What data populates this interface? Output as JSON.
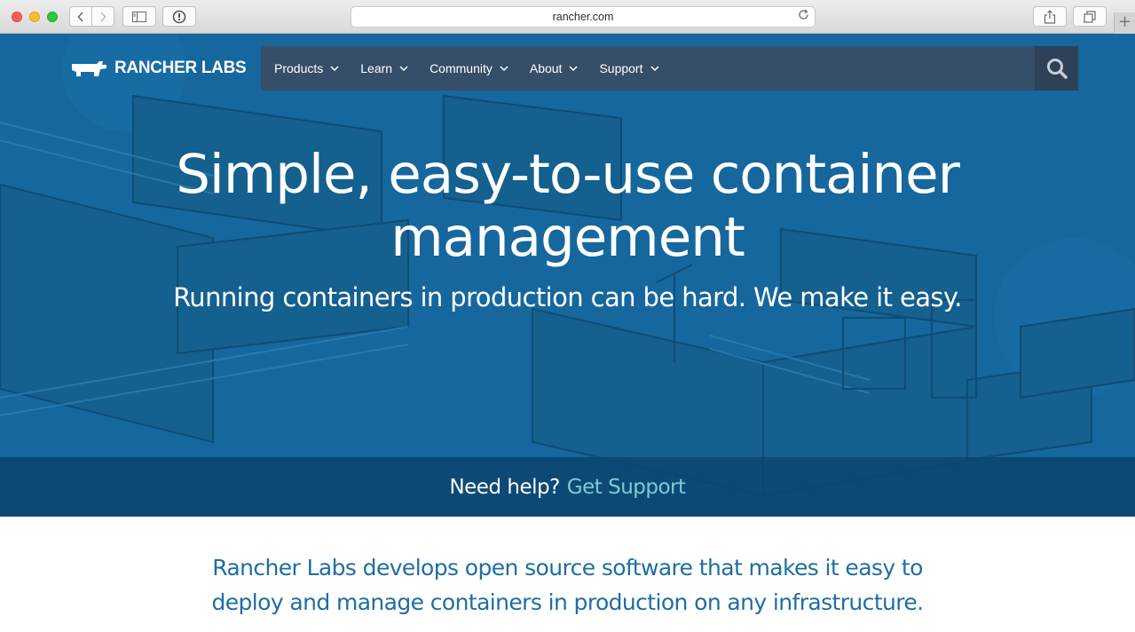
{
  "browser": {
    "url": "rancher.com",
    "back_icon": "chevron-left-icon",
    "forward_icon": "chevron-right-icon",
    "sidebar_icon": "sidebar-icon",
    "reader_icon": "reader-icon",
    "reload_icon": "reload-icon",
    "share_icon": "share-icon",
    "tabs_icon": "tabs-icon",
    "newtab_label": "+"
  },
  "nav": {
    "logo_text": "RANCHER LABS",
    "items": [
      {
        "label": "Products"
      },
      {
        "label": "Learn"
      },
      {
        "label": "Community"
      },
      {
        "label": "About"
      },
      {
        "label": "Support"
      }
    ],
    "search_icon": "search-icon"
  },
  "hero": {
    "headline_line1": "Simple, easy-to-use container",
    "headline_line2": "management",
    "subheadline": "Running containers in production can be hard. We make it easy."
  },
  "helpbar": {
    "text": "Need help?",
    "link": "Get Support"
  },
  "intro": {
    "line1": "Rancher Labs develops open source software that makes it easy to",
    "line2": "deploy and manage containers in production on any infrastructure."
  },
  "colors": {
    "hero_bg": "#16679d",
    "nav_bg": "#374e69",
    "link_accent": "#7ccbd4",
    "intro_text": "#1e6ea3"
  }
}
